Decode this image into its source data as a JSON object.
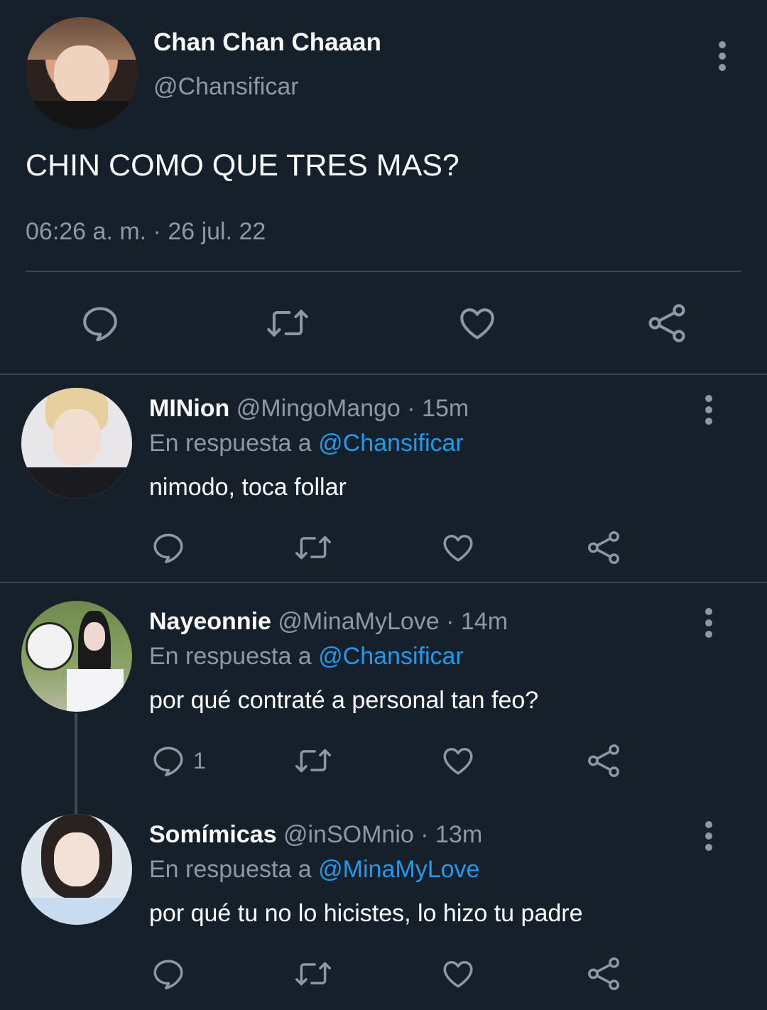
{
  "main_tweet": {
    "display_name": "Chan Chan Chaaan",
    "handle": "@Chansificar",
    "text": "CHIN COMO QUE TRES MAS?",
    "timestamp": "06:26 a. m. · 26 jul. 22"
  },
  "replies": [
    {
      "display_name": "MINion",
      "meta": "@MingoMango · 15m",
      "reply_prefix": "En respuesta a",
      "reply_to": "@Chansificar",
      "text": "nimodo, toca follar",
      "reply_count": ""
    },
    {
      "display_name": "Nayeonnie",
      "meta": "@MinaMyLove · 14m",
      "reply_prefix": "En respuesta a",
      "reply_to": "@Chansificar",
      "text": "por qué contraté a personal tan feo?",
      "reply_count": "1"
    },
    {
      "display_name": "Somímicas",
      "meta": "@inSOMnio · 13m",
      "reply_prefix": "En respuesta a",
      "reply_to": "@MinaMyLove",
      "text": "por qué tu no lo hicistes, lo hizo tu padre",
      "reply_count": ""
    }
  ],
  "colors": {
    "background": "#15202b",
    "text": "#ffffff",
    "secondary": "#8b98a5",
    "link": "#1d9bf0",
    "divider": "#38444d"
  },
  "icons": [
    "reply-icon",
    "retweet-icon",
    "like-icon",
    "share-icon",
    "more-options-icon"
  ]
}
